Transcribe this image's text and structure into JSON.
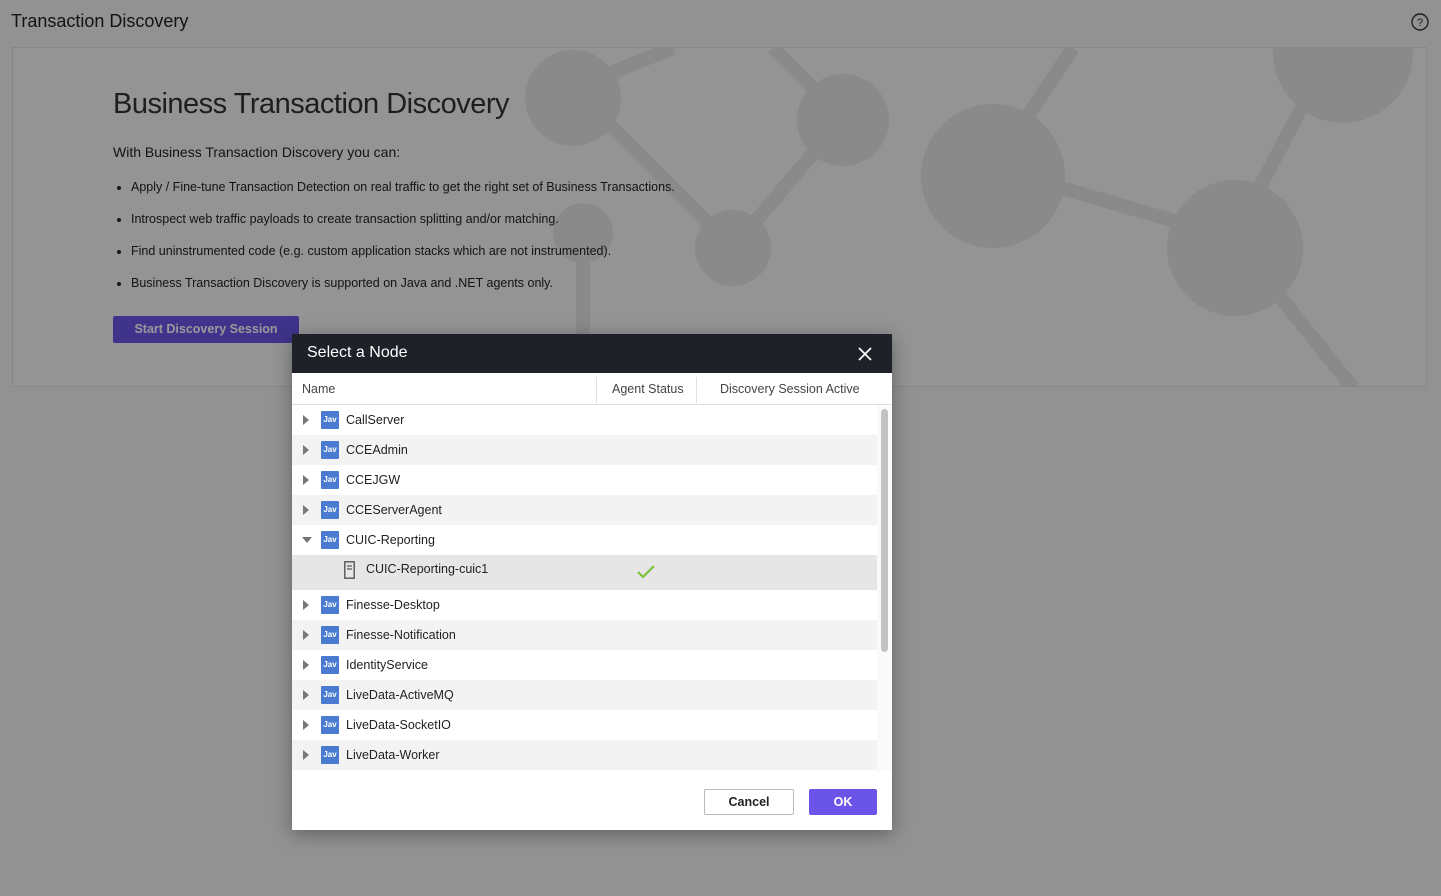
{
  "page": {
    "title": "Transaction Discovery",
    "help_icon": "help-icon"
  },
  "hero": {
    "title": "Business Transaction Discovery",
    "subtitle": "With Business Transaction Discovery you can:",
    "bullets": [
      "Apply / Fine-tune Transaction Detection on real traffic to get the right set of Business Transactions.",
      "Introspect web traffic payloads to create transaction splitting and/or matching.",
      "Find uninstrumented code (e.g. custom application stacks which are not instrumented).",
      "Business Transaction Discovery is supported on Java and .NET agents only."
    ],
    "start_button": "Start Discovery Session"
  },
  "modal": {
    "title": "Select a Node",
    "columns": [
      "Name",
      "Agent Status",
      "Discovery Session Active"
    ],
    "badge": "Jav",
    "tiers": [
      {
        "name": "CallServer",
        "expanded": false
      },
      {
        "name": "CCEAdmin",
        "expanded": false
      },
      {
        "name": "CCEJGW",
        "expanded": false
      },
      {
        "name": "CCEServerAgent",
        "expanded": false
      },
      {
        "name": "CUIC-Reporting",
        "expanded": true
      },
      {
        "name": "Finesse-Desktop",
        "expanded": false
      },
      {
        "name": "Finesse-Notification",
        "expanded": false
      },
      {
        "name": "IdentityService",
        "expanded": false
      },
      {
        "name": "LiveData-ActiveMQ",
        "expanded": false
      },
      {
        "name": "LiveData-SocketIO",
        "expanded": false
      },
      {
        "name": "LiveData-Worker",
        "expanded": false
      }
    ],
    "child_node": {
      "name": "CUIC-Reporting-cuic1",
      "agent_status": "check-icon",
      "selected": true
    },
    "cancel_label": "Cancel",
    "ok_label": "OK"
  },
  "colors": {
    "accent": "#6a55e8",
    "header_bg": "#1f2128",
    "java_badge": "#4a7bd0",
    "check": "#7bc23a"
  }
}
